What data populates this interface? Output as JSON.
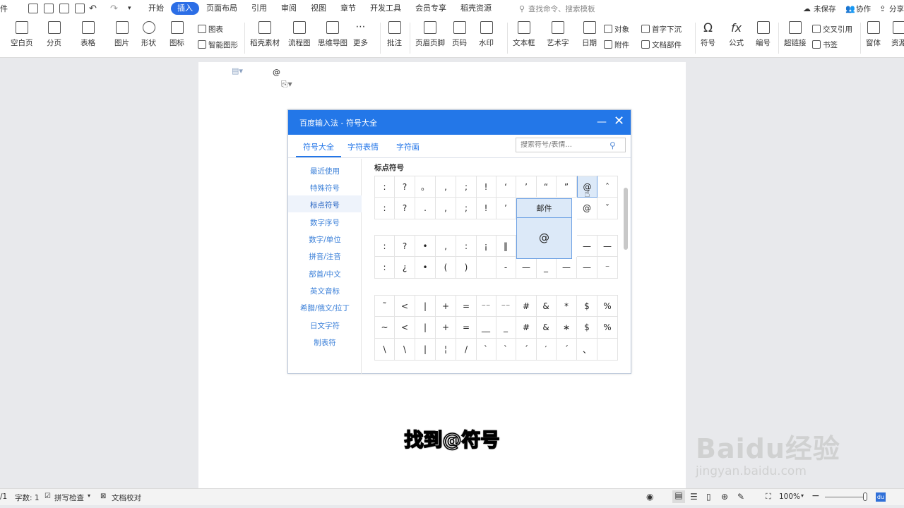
{
  "menubar": {
    "partial_left": "件",
    "items": [
      "开始",
      "插入",
      "页面布局",
      "引用",
      "审阅",
      "视图",
      "章节",
      "开发工具",
      "会员专享",
      "稻壳资源"
    ],
    "search_placeholder": "查找命令、搜索模板",
    "unsaved": "未保存",
    "collab": "协作",
    "share": "分享"
  },
  "ribbon": {
    "blank_page": "空白页",
    "page_break": "分页",
    "table": "表格",
    "picture": "图片",
    "shape": "形状",
    "icon": "图标",
    "chart": "图表",
    "smart_art": "智能图形",
    "docer_material": "稻壳素材",
    "flowchart": "流程图",
    "mindmap": "思维导图",
    "more": "更多",
    "comment": "批注",
    "header_footer": "页眉页脚",
    "page_number": "页码",
    "watermark": "水印",
    "textbox": "文本框",
    "wordart": "艺术字",
    "date": "日期",
    "object": "对象",
    "attachment": "附件",
    "drop_cap": "首字下沉",
    "doc_parts": "文档部件",
    "symbol": "符号",
    "formula": "公式",
    "numbering": "编号",
    "hyperlink": "超链接",
    "cross_ref": "交叉引用",
    "bookmark": "书签",
    "font_partial": "窗体",
    "resource_partial": "资源"
  },
  "document": {
    "typed_char": "@"
  },
  "dialog": {
    "title": "百度输入法 - 符号大全",
    "tabs": [
      "符号大全",
      "字符表情",
      "字符画"
    ],
    "search_placeholder": "搜索符号/表情...",
    "section_title": "标点符号",
    "nav": [
      "最近使用",
      "特殊符号",
      "标点符号",
      "数字序号",
      "数字/单位",
      "拼音/注音",
      "部首/中文",
      "英文音标",
      "希腊/俄文/拉丁",
      "日文字符",
      "制表符"
    ],
    "rows": [
      [
        ":",
        "?",
        "。",
        ",",
        ";",
        "!",
        "‘",
        "’",
        "“",
        "”",
        "@",
        "ˆ"
      ],
      [
        ":",
        "?",
        ".",
        ",",
        ";",
        "!",
        "’",
        "",
        "",
        "",
        "@",
        "ˇ"
      ],
      [
        ":",
        "?",
        "•",
        "‚",
        ":",
        "¡",
        "‖",
        "",
        "",
        "",
        "—",
        "—"
      ],
      [
        ":",
        "¿",
        "•",
        "(",
        ")",
        "",
        "-",
        "—",
        "_",
        "—",
        "—",
        "⁻"
      ],
      [
        "˜",
        "<",
        "|",
        "+",
        "=",
        "⁻⁻",
        "⁻⁻",
        "#",
        "&",
        "*",
        "$",
        "%"
      ],
      [
        "~",
        "<",
        "|",
        "+",
        "=",
        "__",
        "_",
        "#",
        "&",
        "∗",
        "$",
        "%"
      ],
      [
        "\\",
        "\\",
        "|",
        "¦",
        "/",
        "`",
        "ˋ",
        "ˊ",
        "′",
        "ˊ",
        "、",
        ""
      ]
    ],
    "tooltip_title": "邮件",
    "tooltip_char": "@"
  },
  "caption": "找到@符号",
  "watermark": {
    "brand": "Baidu经验",
    "url": "jingyan.baidu.com"
  },
  "status": {
    "page": "/1",
    "word_count": "字数: 1",
    "spell_check": "拼写检查",
    "doc_check": "文档校对",
    "zoom": "100%"
  }
}
